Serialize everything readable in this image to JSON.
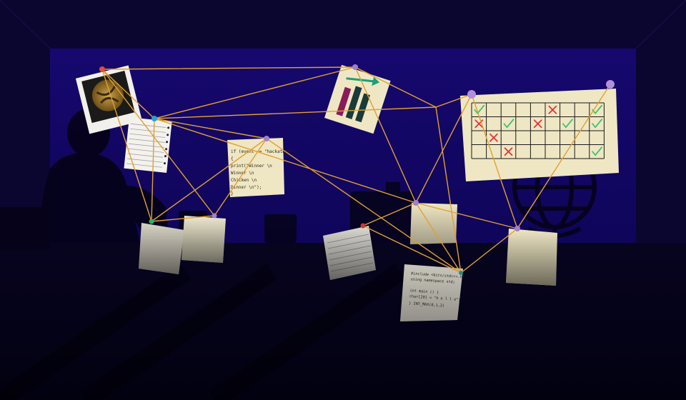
{
  "scene": {
    "colors": {
      "room": "#0a0630",
      "board": "#14066a",
      "paper": "#efe7c4",
      "string": "#e0a030",
      "check": "#3cc46a",
      "cross": "#e0353a"
    }
  },
  "code_note_python": {
    "lines": [
      "if (event == \"hackathon\")",
      "{",
      "    print(\"Winner \\n",
      "            Winner \\n",
      "            Chicken \\n",
      "            Dinner \\n\");",
      "}"
    ]
  },
  "code_note_cpp": {
    "lines": [
      "#include <bits/stdc++.h>",
      "using namespace std;",
      "",
      "int main () {",
      "char[20] = \"h e l l o\";",
      "}        INT_MAX(0,1,2)"
    ]
  },
  "checklist_grid": {
    "marks": [
      [
        "check",
        "",
        "",
        "",
        "",
        "cross",
        "",
        "",
        "check"
      ],
      [
        "cross",
        "",
        "check",
        "",
        "cross",
        "",
        "check",
        "",
        "check"
      ],
      [
        "",
        "cross",
        "",
        "",
        "",
        "",
        "",
        "",
        ""
      ],
      [
        "",
        "",
        "cross",
        "",
        "",
        "",
        "",
        "",
        "check"
      ]
    ]
  }
}
